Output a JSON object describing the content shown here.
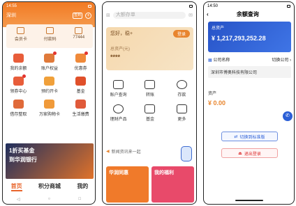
{
  "screen1": {
    "status": {
      "time": "14:55"
    },
    "header": {
      "location": "深圳",
      "sign_label": "签到"
    },
    "card": [
      {
        "label": "会员卡",
        "icon": "card-icon"
      },
      {
        "label": "付款码",
        "icon": "qr-icon"
      },
      {
        "label": "77444",
        "icon": "wallet-icon"
      }
    ],
    "grid": [
      {
        "label": "我的余额",
        "color": "#e85d3a"
      },
      {
        "label": "账户权益",
        "color": "#e07a3a"
      },
      {
        "label": "优惠券",
        "color": "#f08a3a"
      },
      {
        "label": "领券中心",
        "color": "#e85d3a"
      },
      {
        "label": "预约开卡",
        "color": "#f0a03a"
      },
      {
        "label": "基金",
        "color": "#e0502a"
      },
      {
        "label": "借存整取",
        "color": "#e06a3a"
      },
      {
        "label": "万家购物卡",
        "color": "#f09a3a"
      },
      {
        "label": "生活缴费",
        "color": "#e05a3a"
      }
    ],
    "banner": {
      "line1": "1折买基金",
      "line2": "到华润银行"
    },
    "tabs": {
      "home": "首页",
      "mall": "积分商城",
      "mine": "我的"
    }
  },
  "screen2": {
    "search_placeholder": "大额存单",
    "greeting": "您好，稳+",
    "login_label": "登录",
    "asset_label": "总资产(元)",
    "asset_value": "****",
    "grid": [
      {
        "label": "账户查询",
        "icon": "account-icon"
      },
      {
        "label": "转账",
        "icon": "transfer-icon"
      },
      {
        "label": "存款",
        "icon": "piggy-icon"
      },
      {
        "label": "理财产品",
        "icon": "wealth-icon"
      },
      {
        "label": "基金",
        "icon": "fund-icon"
      },
      {
        "label": "更多",
        "icon": "more-icon"
      }
    ],
    "notice": "新闻资讯来一起",
    "promos": [
      {
        "label": "华润同惠",
        "color": "#f07a2a"
      },
      {
        "label": "我的福利",
        "color": "#e84a6a"
      }
    ]
  },
  "screen3": {
    "status": {
      "time": "14:50"
    },
    "title": "余额查询",
    "total_label": "总资产",
    "total_value": "¥ 1,217,293,252.28",
    "company_label": "公司名称",
    "switch_company": "切换公司",
    "company_name": "深圳市博奥科技有限公司",
    "net_label": "资产",
    "net_value": "¥ 0.00",
    "switch_button": "切换到标准版",
    "logout_button": "退出登录"
  }
}
